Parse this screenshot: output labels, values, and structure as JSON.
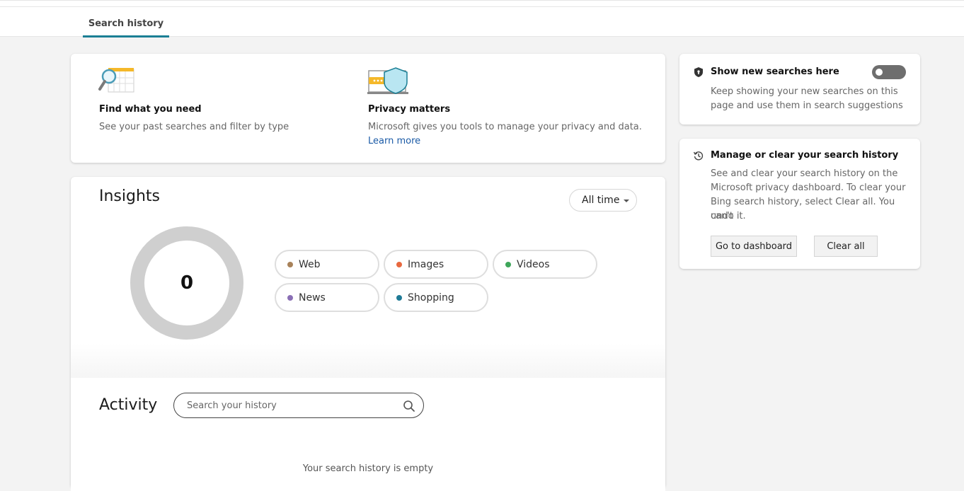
{
  "tabs": {
    "active_label": "Search history"
  },
  "info": {
    "find": {
      "title": "Find what you need",
      "desc": "See your past searches and filter by type"
    },
    "privacy": {
      "title": "Privacy matters",
      "desc": "Microsoft gives you tools to manage your privacy and data.",
      "link": "Learn more"
    }
  },
  "insights": {
    "title": "Insights",
    "time_filter": "All time",
    "total": "0",
    "categories": [
      {
        "label": "Web",
        "color": "#a8825a"
      },
      {
        "label": "Images",
        "color": "#e8683f"
      },
      {
        "label": "Videos",
        "color": "#3fa65a"
      },
      {
        "label": "News",
        "color": "#8a6fb5"
      },
      {
        "label": "Shopping",
        "color": "#1f7a96"
      }
    ]
  },
  "activity": {
    "title": "Activity",
    "search_placeholder": "Search your history",
    "empty_text": "Your search history is empty"
  },
  "sidebar": {
    "show_new": {
      "title": "Show new searches here",
      "desc_line1": "Keep showing your new searches on this",
      "desc_line2": "page and use them in search suggestions",
      "toggle_on": false
    },
    "manage": {
      "title": "Manage or clear your search history",
      "desc_line1": "See and clear your search history on the",
      "desc_line2": "Microsoft privacy dashboard. To clear your",
      "desc_line3": "Bing search history, select Clear all. You can't",
      "desc_line4": "undo it.",
      "dashboard_button": "Go to dashboard",
      "clear_button": "Clear all"
    }
  },
  "colors": {
    "accent": "#1b7f95",
    "link": "#1a5aa6",
    "donut": "#cfcfcf",
    "toggle_off": "#6e6e6e"
  }
}
